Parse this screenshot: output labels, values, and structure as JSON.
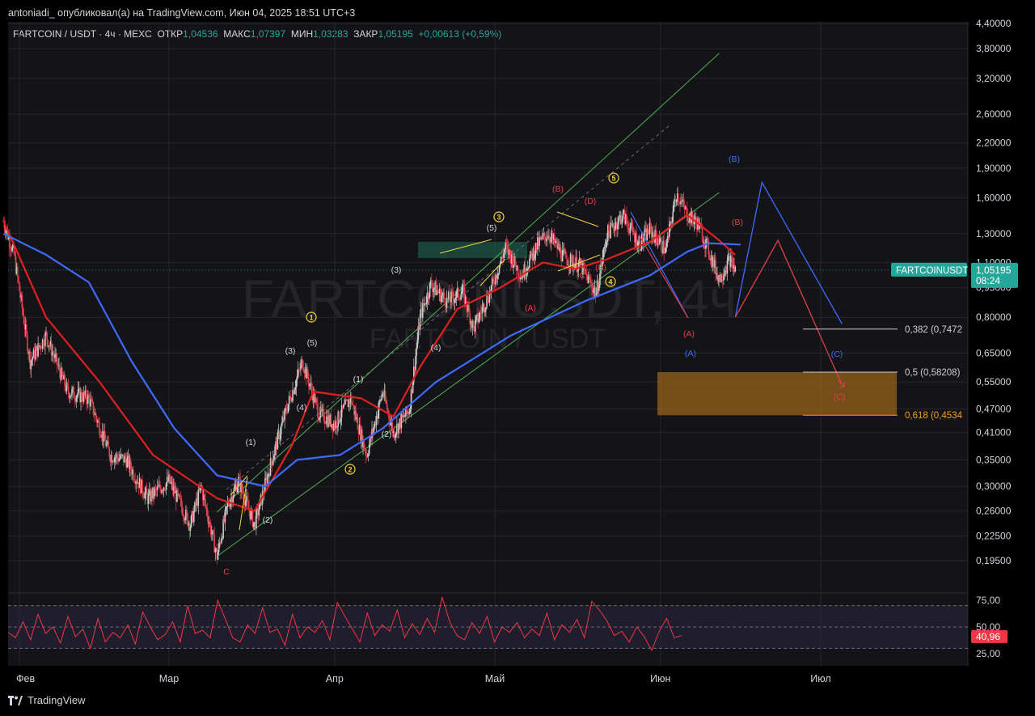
{
  "header": {
    "published": "antoniadi_ опубликовал(а) на TradingView.com, Июн 04, 2025 18:51 UTC+3"
  },
  "symbol_line": {
    "name": "FARTCOIN / USDT · 4ч · MEXC",
    "open_label": "ОТКР",
    "open": "1,04536",
    "high_label": "МАКС",
    "high": "1,07397",
    "low_label": "МИН",
    "low": "1,03283",
    "close_label": "ЗАКР",
    "close": "1,05195",
    "change": "+0,00613 (+0,59%)"
  },
  "watermark": {
    "main": "FARTCOINUSDT, 4ч",
    "sub": "FARTCOIN / USDT"
  },
  "price_badge": {
    "ticker": "FARTCOINUSDT",
    "price": "1,05195",
    "timer": "08:24"
  },
  "rsi_badge": "40,96",
  "footer": {
    "brand": "TradingView"
  },
  "colors": {
    "background": "#141418",
    "grid": "#26262b",
    "up": "#c9c9c9",
    "down": "#e0404a",
    "ma_red": "#e02020",
    "ma_blue": "#3d6bff",
    "channel": "#4caf50",
    "wave_yellow": "#f2d43a",
    "rsi_line": "#f23645",
    "rsi_band": "#2a2540",
    "fib_zone": "#b8741a",
    "badge": "#26a69a"
  },
  "chart_data": [
    {
      "type": "candlestick",
      "title": "FARTCOIN / USDT · 4ч · MEXC",
      "y_scale": "log",
      "y_ticks": [
        "4,40000",
        "3,80000",
        "3,20000",
        "2,60000",
        "2,20000",
        "1,90000",
        "1,60000",
        "1,30000",
        "1,10000",
        "0,95000",
        "0,80000",
        "0,65000",
        "0,55000",
        "0,47000",
        "0,41000",
        "0,35000",
        "0,30000",
        "0,26000",
        "0,22500",
        "0,19500"
      ],
      "x_ticks": [
        "Фев",
        "Мар",
        "Апр",
        "Май",
        "Июн",
        "Июл"
      ],
      "price_path": [
        {
          "x": "2025-01-29",
          "y": 1.4
        },
        {
          "x": "2025-01-31",
          "y": 1.15
        },
        {
          "x": "2025-02-03",
          "y": 0.62
        },
        {
          "x": "2025-02-06",
          "y": 0.72
        },
        {
          "x": "2025-02-10",
          "y": 0.52
        },
        {
          "x": "2025-02-14",
          "y": 0.5
        },
        {
          "x": "2025-02-18",
          "y": 0.36
        },
        {
          "x": "2025-02-21",
          "y": 0.35
        },
        {
          "x": "2025-02-25",
          "y": 0.28
        },
        {
          "x": "2025-03-01",
          "y": 0.31
        },
        {
          "x": "2025-03-05",
          "y": 0.24
        },
        {
          "x": "2025-03-07",
          "y": 0.3
        },
        {
          "x": "2025-03-10",
          "y": 0.2
        },
        {
          "x": "2025-03-12",
          "y": 0.27
        },
        {
          "x": "2025-03-14",
          "y": 0.31
        },
        {
          "x": "2025-03-17",
          "y": 0.24
        },
        {
          "x": "2025-03-20",
          "y": 0.34
        },
        {
          "x": "2025-03-23",
          "y": 0.47
        },
        {
          "x": "2025-03-26",
          "y": 0.62
        },
        {
          "x": "2025-03-29",
          "y": 0.46
        },
        {
          "x": "2025-04-01",
          "y": 0.43
        },
        {
          "x": "2025-04-04",
          "y": 0.5
        },
        {
          "x": "2025-04-07",
          "y": 0.36
        },
        {
          "x": "2025-04-10",
          "y": 0.52
        },
        {
          "x": "2025-04-12",
          "y": 0.41
        },
        {
          "x": "2025-04-15",
          "y": 0.47
        },
        {
          "x": "2025-04-17",
          "y": 0.8
        },
        {
          "x": "2025-04-19",
          "y": 0.97
        },
        {
          "x": "2025-04-22",
          "y": 0.88
        },
        {
          "x": "2025-04-25",
          "y": 0.93
        },
        {
          "x": "2025-04-27",
          "y": 0.75
        },
        {
          "x": "2025-04-30",
          "y": 0.92
        },
        {
          "x": "2025-05-03",
          "y": 1.2
        },
        {
          "x": "2025-05-06",
          "y": 1.02
        },
        {
          "x": "2025-05-09",
          "y": 1.22
        },
        {
          "x": "2025-05-11",
          "y": 1.3
        },
        {
          "x": "2025-05-14",
          "y": 1.13
        },
        {
          "x": "2025-05-17",
          "y": 1.08
        },
        {
          "x": "2025-05-20",
          "y": 0.92
        },
        {
          "x": "2025-05-22",
          "y": 1.3
        },
        {
          "x": "2025-05-25",
          "y": 1.45
        },
        {
          "x": "2025-05-28",
          "y": 1.22
        },
        {
          "x": "2025-05-30",
          "y": 1.33
        },
        {
          "x": "2025-06-02",
          "y": 1.18
        },
        {
          "x": "2025-06-04",
          "y": 1.65
        },
        {
          "x": "2025-06-06",
          "y": 1.45
        },
        {
          "x": "2025-06-08",
          "y": 1.38
        },
        {
          "x": "2025-06-10",
          "y": 1.18
        },
        {
          "x": "2025-06-12",
          "y": 1.0
        },
        {
          "x": "2025-06-14",
          "y": 1.12
        },
        {
          "x": "2025-06-15",
          "y": 1.05
        }
      ],
      "moving_averages": [
        {
          "color": "#e02020",
          "points": [
            {
              "x": "2025-01-29",
              "y": 1.4
            },
            {
              "x": "2025-02-06",
              "y": 0.8
            },
            {
              "x": "2025-02-16",
              "y": 0.55
            },
            {
              "x": "2025-02-26",
              "y": 0.36
            },
            {
              "x": "2025-03-10",
              "y": 0.28
            },
            {
              "x": "2025-03-17",
              "y": 0.26
            },
            {
              "x": "2025-03-24",
              "y": 0.38
            },
            {
              "x": "2025-03-28",
              "y": 0.52
            },
            {
              "x": "2025-04-06",
              "y": 0.5
            },
            {
              "x": "2025-04-12",
              "y": 0.45
            },
            {
              "x": "2025-04-17",
              "y": 0.6
            },
            {
              "x": "2025-04-24",
              "y": 0.84
            },
            {
              "x": "2025-05-02",
              "y": 0.95
            },
            {
              "x": "2025-05-10",
              "y": 1.1
            },
            {
              "x": "2025-05-16",
              "y": 1.06
            },
            {
              "x": "2025-05-22",
              "y": 1.12
            },
            {
              "x": "2025-05-30",
              "y": 1.24
            },
            {
              "x": "2025-06-06",
              "y": 1.45
            },
            {
              "x": "2025-06-12",
              "y": 1.25
            },
            {
              "x": "2025-06-15",
              "y": 1.15
            }
          ]
        },
        {
          "color": "#3d6bff",
          "points": [
            {
              "x": "2025-01-29",
              "y": 1.3
            },
            {
              "x": "2025-02-06",
              "y": 1.15
            },
            {
              "x": "2025-02-14",
              "y": 0.98
            },
            {
              "x": "2025-02-22",
              "y": 0.62
            },
            {
              "x": "2025-03-02",
              "y": 0.42
            },
            {
              "x": "2025-03-10",
              "y": 0.32
            },
            {
              "x": "2025-03-19",
              "y": 0.3
            },
            {
              "x": "2025-03-25",
              "y": 0.35
            },
            {
              "x": "2025-04-02",
              "y": 0.36
            },
            {
              "x": "2025-04-10",
              "y": 0.42
            },
            {
              "x": "2025-04-20",
              "y": 0.55
            },
            {
              "x": "2025-05-04",
              "y": 0.72
            },
            {
              "x": "2025-05-18",
              "y": 0.88
            },
            {
              "x": "2025-05-30",
              "y": 1.02
            },
            {
              "x": "2025-06-06",
              "y": 1.17
            },
            {
              "x": "2025-06-10",
              "y": 1.23
            },
            {
              "x": "2025-06-16",
              "y": 1.22
            }
          ]
        }
      ],
      "wave_labels": {
        "circled": [
          "1",
          "2",
          "3",
          "4",
          "5"
        ],
        "white": [
          "(1)",
          "(2)",
          "(3)",
          "(4)",
          "(5)",
          "(1)",
          "(2)",
          "(3)",
          "(4)",
          "(5)",
          "(3)",
          "(4)"
        ],
        "red": [
          "C",
          "(A)",
          "(B)",
          "(C)",
          "(D)",
          "(E)",
          "(A)",
          "(B)",
          "(C)"
        ],
        "blue": [
          "(A)",
          "(B)",
          "(C)"
        ]
      },
      "projection_red": [
        {
          "x": "2025-06-15",
          "y": 0.8
        },
        {
          "x": "2025-06-23",
          "y": 1.25
        },
        {
          "x": "2025-07-05",
          "y": 0.54
        }
      ],
      "projection_blue": [
        {
          "x": "2025-06-15",
          "y": 0.8
        },
        {
          "x": "2025-06-20",
          "y": 1.75
        },
        {
          "x": "2025-07-05",
          "y": 0.77
        }
      ],
      "fibonacci": [
        {
          "ratio": "0,382",
          "value": 0.7472,
          "label": "0,382 (0,7472"
        },
        {
          "ratio": "0,5",
          "value": 0.58208,
          "label": "0,5 (0,58208)"
        },
        {
          "ratio": "0,618",
          "value": 0.4534,
          "label": "0,618 (0,4534"
        }
      ],
      "target_zone": [
        0.4534,
        0.58208
      ],
      "channel": {
        "lower_start": {
          "x": "2025-03-10",
          "y": 0.2
        },
        "lower_end": {
          "x": "2025-06-12",
          "y": 1.65
        },
        "upper_start": {
          "x": "2025-03-10",
          "y": 0.45
        },
        "upper_end": {
          "x": "2025-06-12",
          "y": 3.7
        }
      }
    },
    {
      "type": "line",
      "title": "RSI",
      "y_ticks": [
        "75,00",
        "50,00",
        "25,00"
      ],
      "bands": [
        70,
        50,
        30
      ],
      "ylim": [
        20,
        80
      ],
      "current": 40.96,
      "values": [
        45,
        40,
        55,
        38,
        62,
        44,
        50,
        35,
        60,
        41,
        48,
        30,
        58,
        36,
        45,
        40,
        52,
        34,
        64,
        50,
        38,
        43,
        55,
        36,
        70,
        44,
        47,
        40,
        75,
        58,
        40,
        36,
        52,
        44,
        68,
        45,
        48,
        33,
        62,
        40,
        50,
        45,
        56,
        38,
        73,
        60,
        48,
        36,
        63,
        42,
        52,
        46,
        66,
        40,
        53,
        43,
        58,
        45,
        78,
        55,
        42,
        38,
        54,
        44,
        60,
        36,
        50,
        45,
        54,
        40,
        48,
        42,
        63,
        38,
        52,
        45,
        57,
        40,
        74,
        66,
        56,
        42,
        46,
        36,
        50,
        41,
        28,
        46,
        58,
        40,
        42
      ]
    }
  ]
}
